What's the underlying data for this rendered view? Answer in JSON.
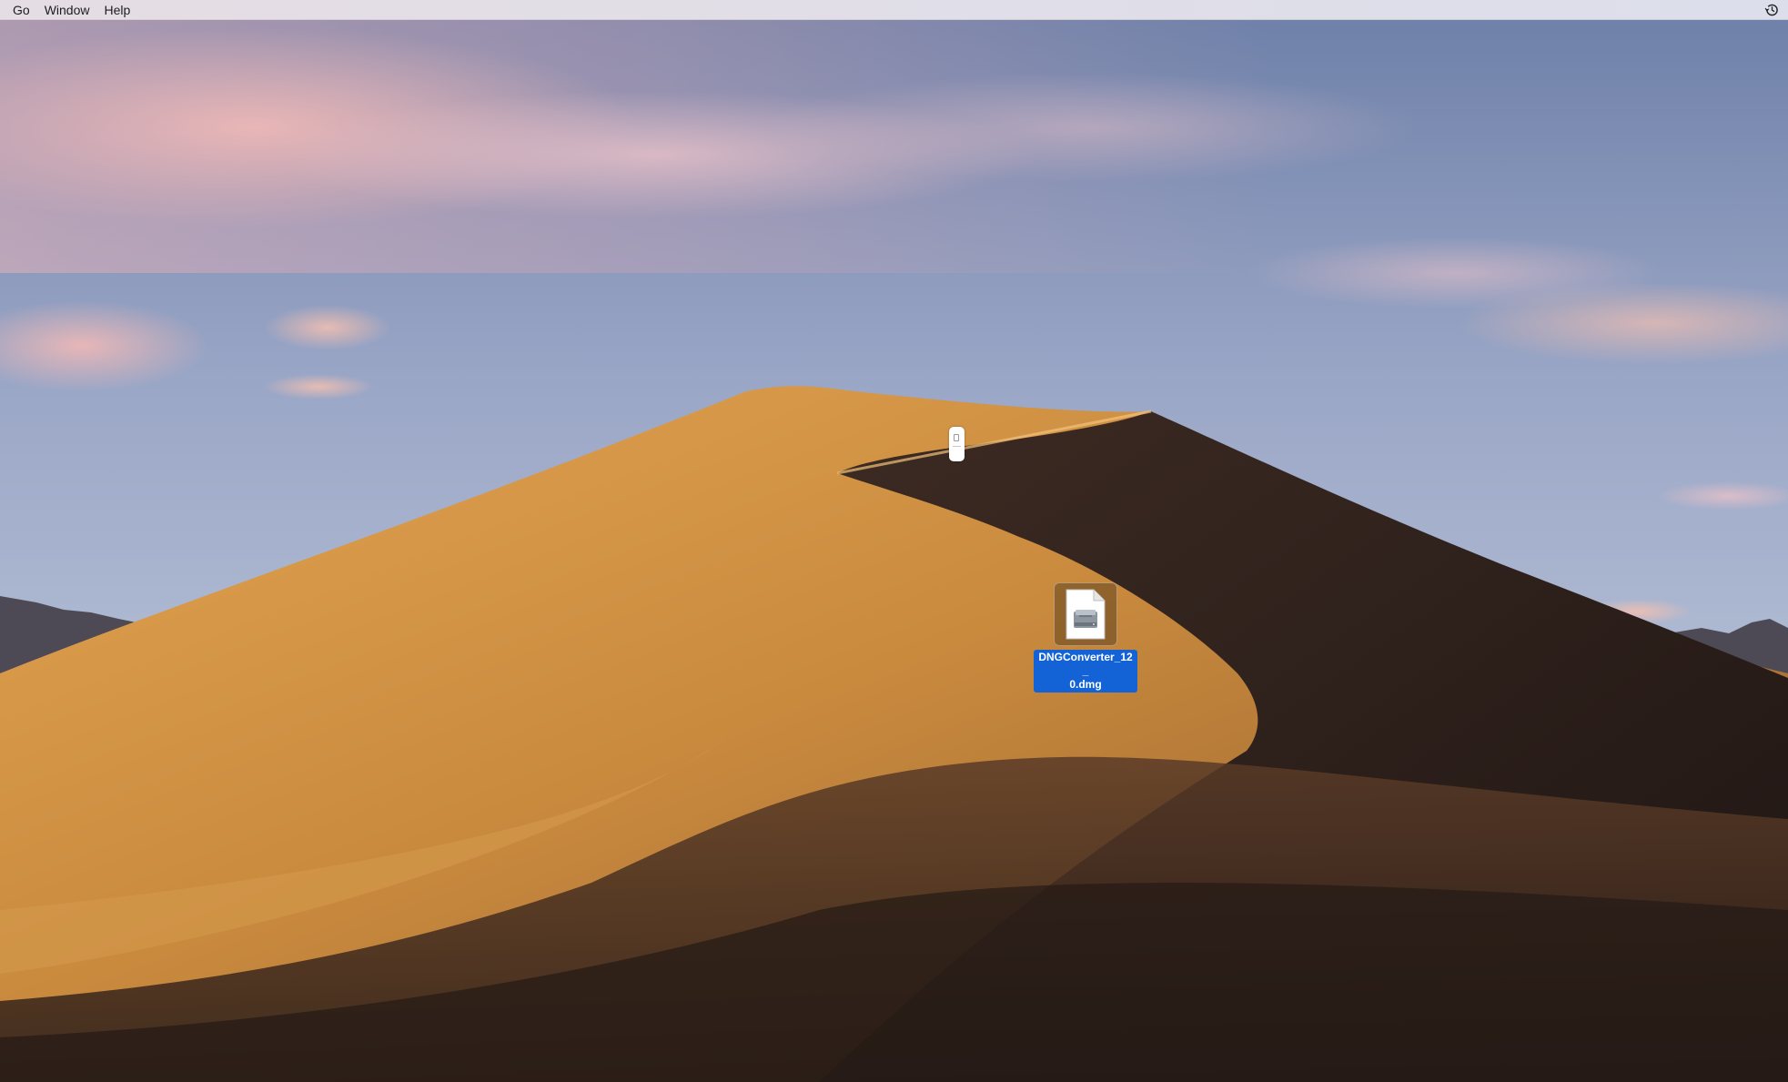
{
  "menubar": {
    "items": [
      {
        "label": "Go"
      },
      {
        "label": "Window"
      },
      {
        "label": "Help"
      }
    ],
    "status_icon": "time-machine-icon"
  },
  "desktop": {
    "wallpaper": "mojave-day-dune",
    "items": [
      {
        "name": "DNGConverter_12_0.dmg",
        "label_line1": "DNGConverter_12_",
        "label_line2": "0.dmg",
        "icon": "disk-image-icon",
        "selected": true
      }
    ]
  },
  "colors": {
    "selection": "#1463d6",
    "sky_top": "#6a83b0",
    "dune_light": "#d8994a",
    "dune_shadow": "#2e211d"
  }
}
